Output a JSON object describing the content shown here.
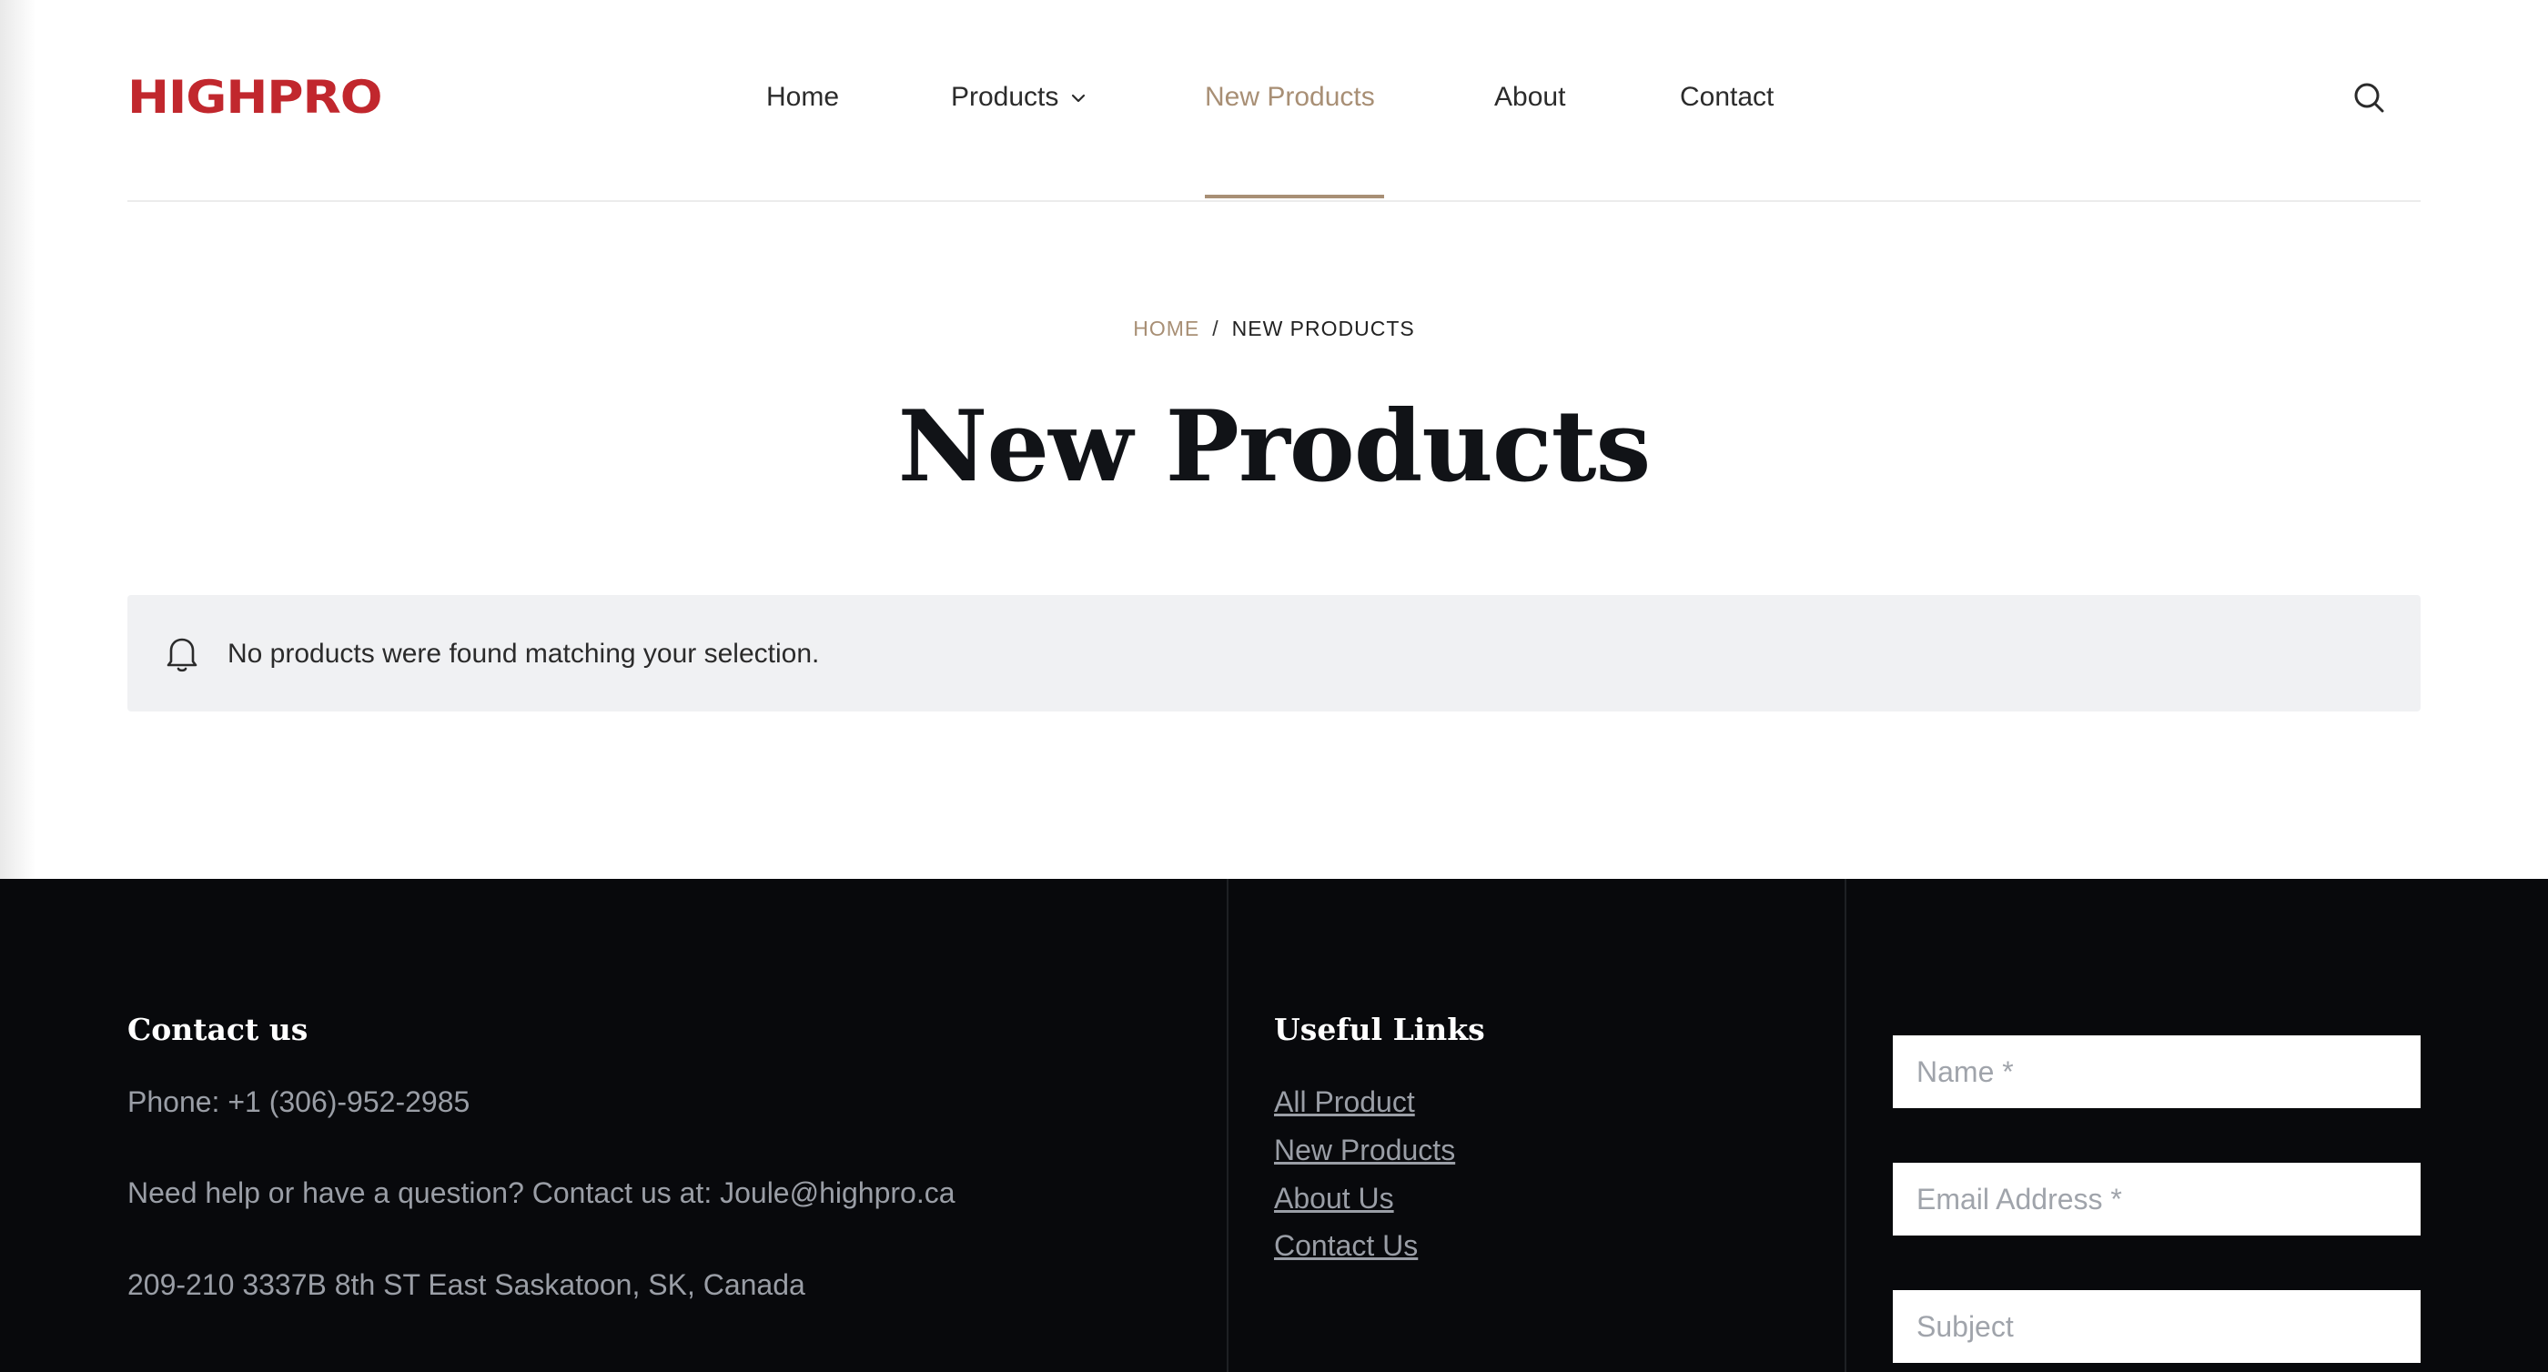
{
  "brand": {
    "logo_text": "HIGHPRO",
    "logo_color": "#c1272d",
    "accent_color": "#a88f75"
  },
  "nav": {
    "items": [
      {
        "label": "Home"
      },
      {
        "label": "Products",
        "has_dropdown": true,
        "icon": "chevron-down-icon"
      },
      {
        "label": "New Products",
        "active": true
      },
      {
        "label": "About"
      },
      {
        "label": "Contact"
      }
    ],
    "search_icon": "search-icon"
  },
  "breadcrumb": {
    "home": "HOME",
    "separator": "/",
    "current": "NEW PRODUCTS"
  },
  "page": {
    "title": "New Products"
  },
  "notice": {
    "icon": "bell-icon",
    "text": "No products were found matching your selection."
  },
  "footer": {
    "contact": {
      "heading": "Contact us",
      "phone": "Phone: +1 (306)-952-2985",
      "help": "Need help or have a question? Contact us at: Joule@highpro.ca",
      "address": "209-210 3337B 8th ST East Saskatoon, SK, Canada"
    },
    "links": {
      "heading": "Useful Links",
      "items": [
        "All Product",
        "New Products",
        "About Us",
        "Contact Us"
      ]
    },
    "form": {
      "name_placeholder": "Name *",
      "email_placeholder": "Email Address *",
      "subject_placeholder": "Subject"
    }
  }
}
